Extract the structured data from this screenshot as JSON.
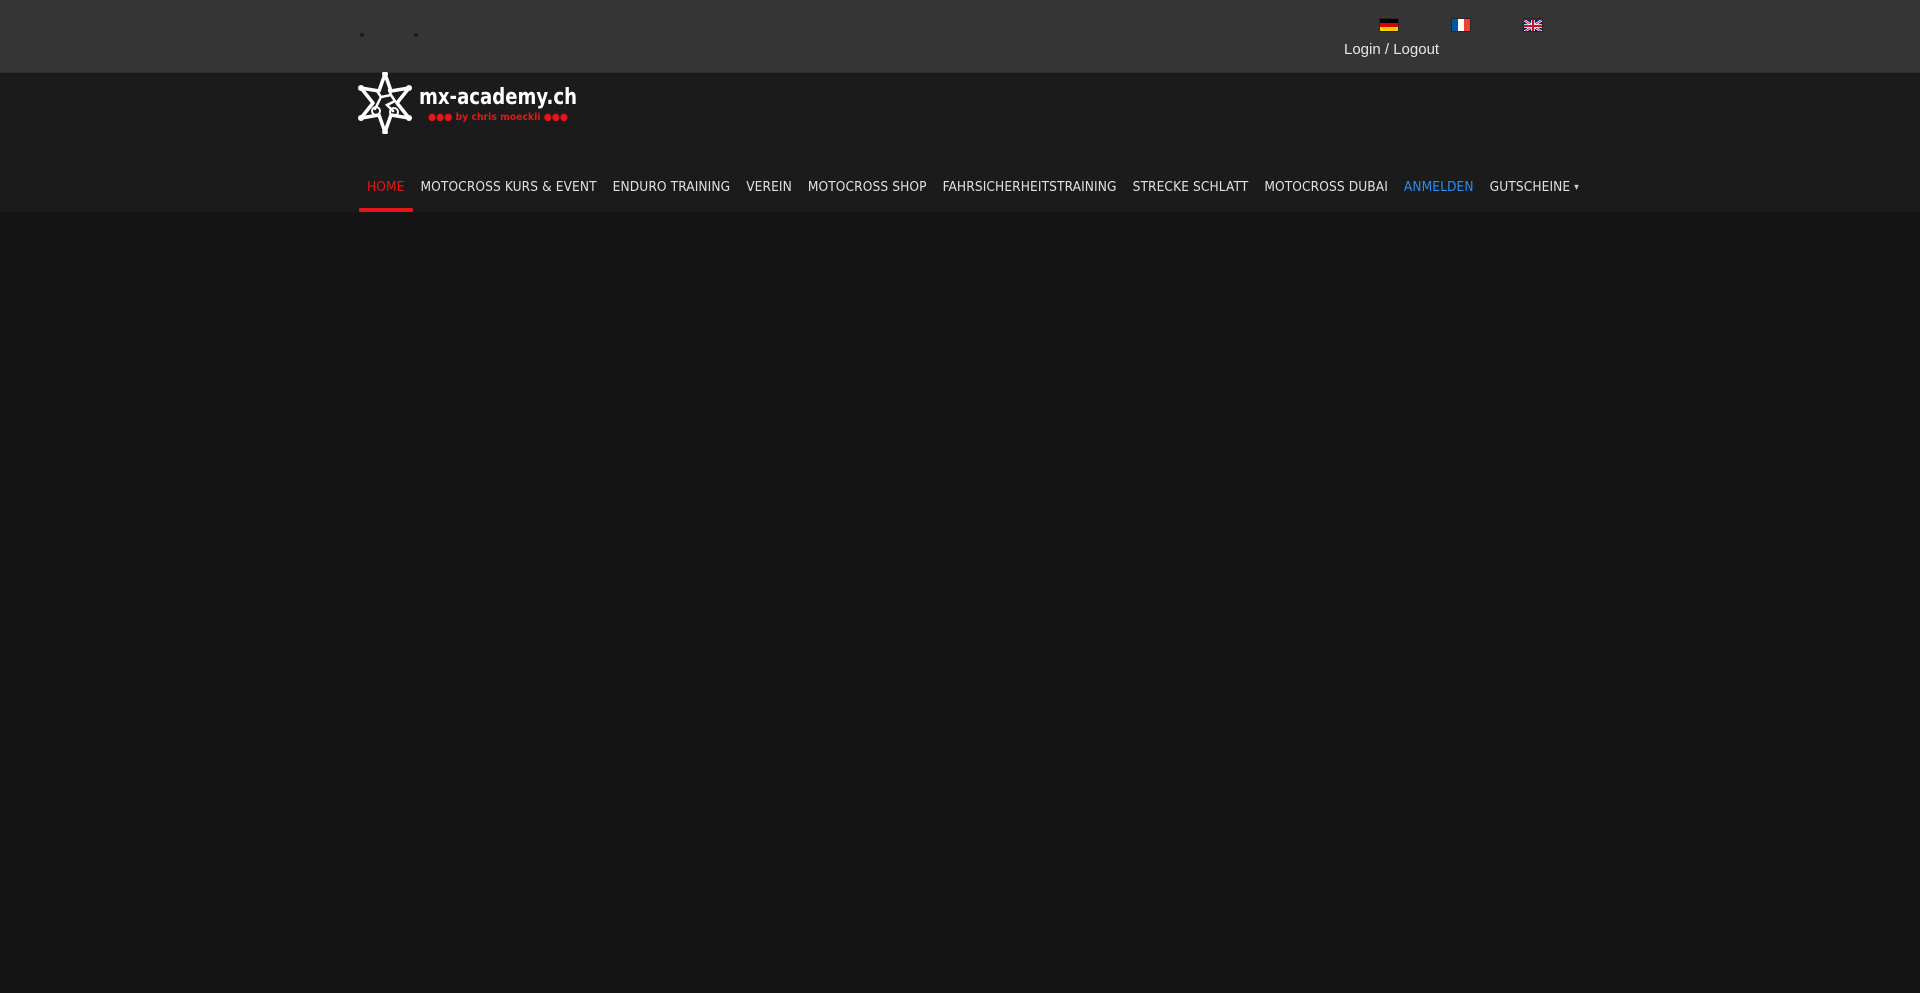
{
  "topbar": {
    "languages": [
      {
        "code": "de",
        "name": "Deutsch",
        "colors": [
          "#000000",
          "#dd0000",
          "#ffce00"
        ]
      },
      {
        "code": "fr",
        "name": "Français",
        "colors": [
          "#0055a4",
          "#ffffff",
          "#ef4135"
        ]
      },
      {
        "code": "en",
        "name": "English",
        "colors": [
          "#012169",
          "#ffffff",
          "#c8102e"
        ]
      }
    ],
    "login_label": "Login / Logout"
  },
  "logo": {
    "title": "mx-academy.ch",
    "subtitle": "●●● by chris moeckli ●●●"
  },
  "nav": {
    "items": [
      {
        "label": "HOME"
      },
      {
        "label": "MOTOCROSS KURS & EVENT"
      },
      {
        "label": "ENDURO TRAINING"
      },
      {
        "label": "VEREIN"
      },
      {
        "label": "MOTOCROSS SHOP"
      },
      {
        "label": "FAHRSICHERHEITSTRAINING"
      },
      {
        "label": "STRECKE SCHLATT"
      },
      {
        "label": "MOTOCROSS DUBAI"
      },
      {
        "label": "ANMELDEN"
      },
      {
        "label": "GUTSCHEINE"
      }
    ],
    "active_color": "#e4161a",
    "highlight_color": "#2a8cf0"
  }
}
